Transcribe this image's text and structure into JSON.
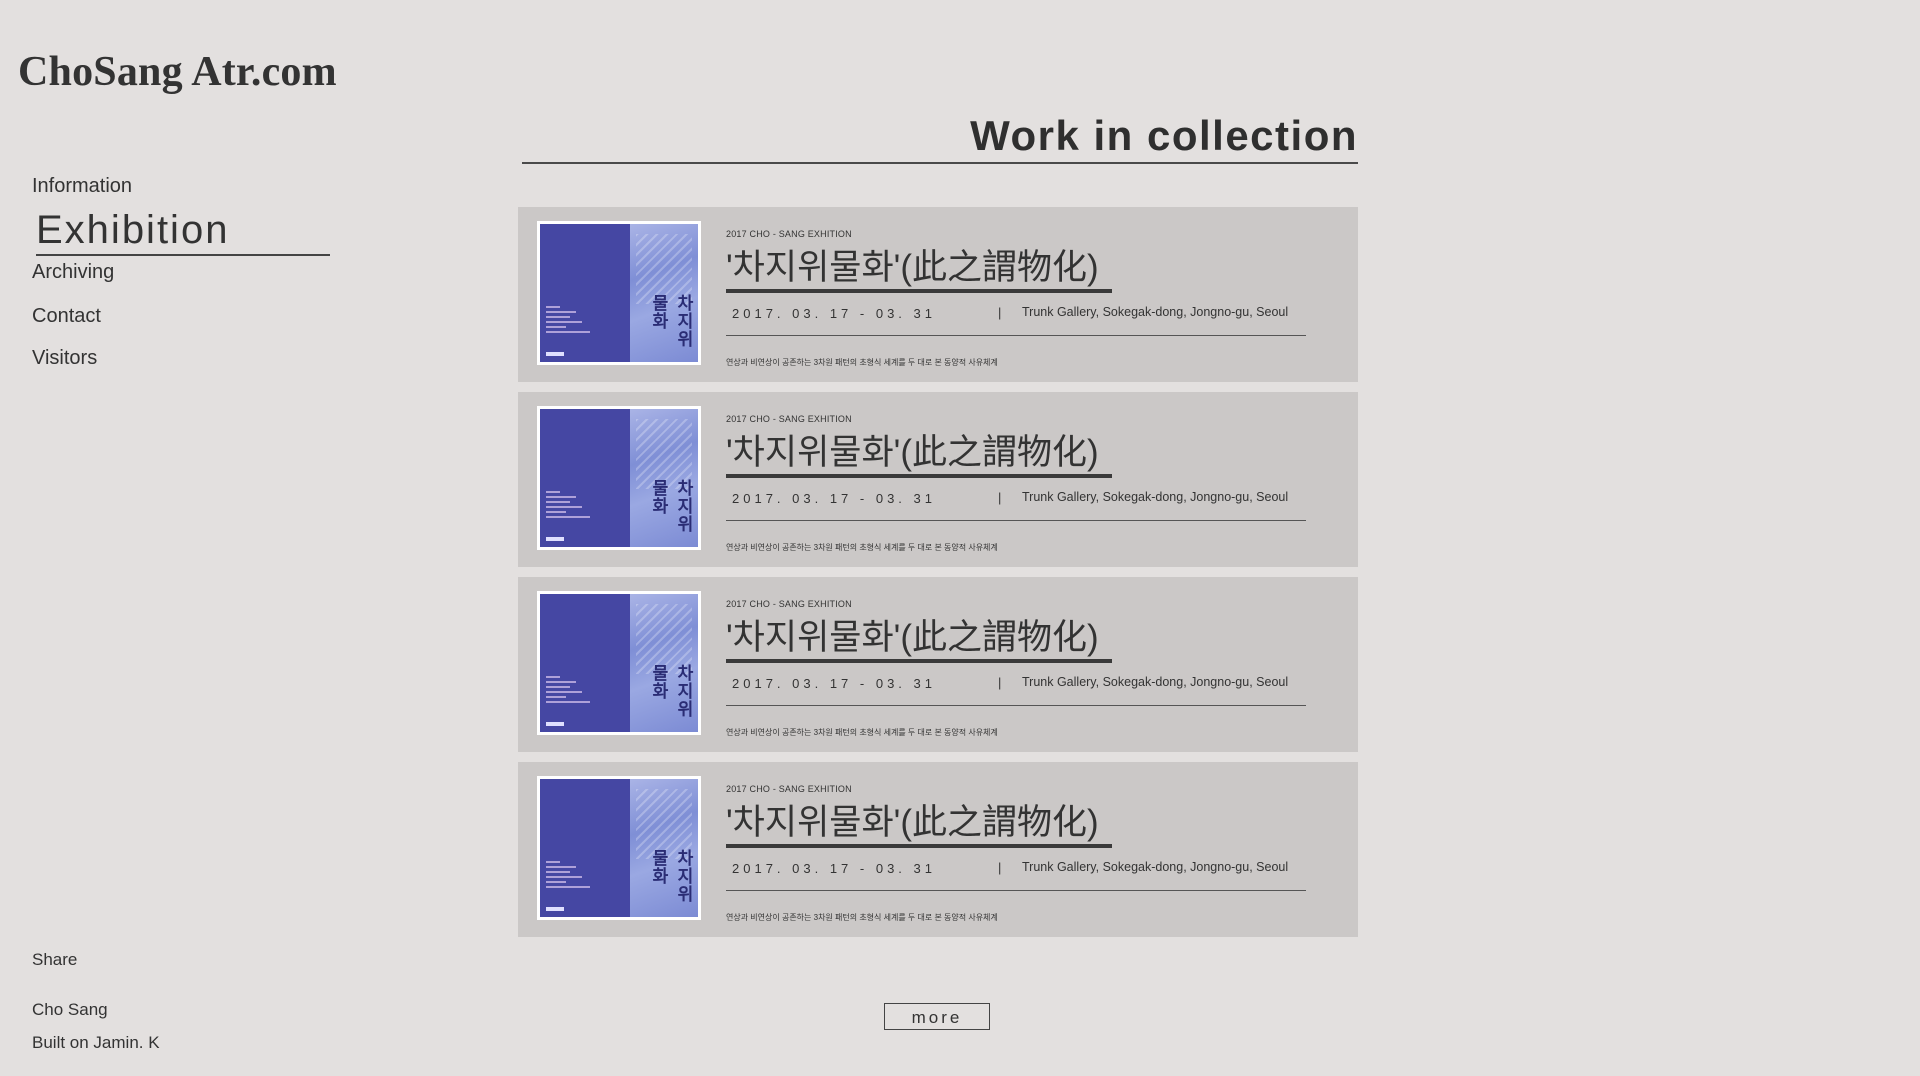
{
  "site": {
    "logo": "ChoSang Atr.com"
  },
  "nav": {
    "items": [
      {
        "label": "Information"
      },
      {
        "label": "Exhibition"
      },
      {
        "label": "Archiving"
      },
      {
        "label": "Contact"
      },
      {
        "label": "Visitors"
      }
    ],
    "active": "Exhibition"
  },
  "main": {
    "title": "Work in collection",
    "cards": [
      {
        "kicker": "2017   CHO - SANG   EXHITION",
        "title": "'차지위물화'(此之謂物化)",
        "date": "2017. 03. 17  -  03. 31",
        "separator": "|",
        "venue": "Trunk Gallery, Sokegak-dong, Jongno-gu, Seoul",
        "description": "연상과 비연상이 공존하는 3차원 패턴의 초형식 세계를 두 대로 본 동양적 사유체계",
        "poster_text": "차지위물화"
      },
      {
        "kicker": "2017   CHO - SANG   EXHITION",
        "title": "'차지위물화'(此之謂物化)",
        "date": "2017. 03. 17  -  03. 31",
        "separator": "|",
        "venue": "Trunk Gallery, Sokegak-dong, Jongno-gu, Seoul",
        "description": "연상과 비연상이 공존하는 3차원 패턴의 초형식 세계를 두 대로 본 동양적 사유체계",
        "poster_text": "차지위물화"
      },
      {
        "kicker": "2017   CHO - SANG   EXHITION",
        "title": "'차지위물화'(此之謂物化)",
        "date": "2017. 03. 17  -  03. 31",
        "separator": "|",
        "venue": "Trunk Gallery, Sokegak-dong, Jongno-gu, Seoul",
        "description": "연상과 비연상이 공존하는 3차원 패턴의 초형식 세계를 두 대로 본 동양적 사유체계",
        "poster_text": "차지위물화"
      },
      {
        "kicker": "2017   CHO - SANG   EXHITION",
        "title": "'차지위물화'(此之謂物化)",
        "date": "2017. 03. 17  -  03. 31",
        "separator": "|",
        "venue": "Trunk Gallery, Sokegak-dong, Jongno-gu, Seoul",
        "description": "연상과 비연상이 공존하는 3차원 패턴의 초형식 세계를 두 대로 본 동양적 사유체계",
        "poster_text": "차지위물화"
      }
    ],
    "more_label": "more"
  },
  "footer": {
    "share": "Share",
    "author": "Cho Sang",
    "built": "Built on Jamin. K"
  },
  "colors": {
    "background": "#e3e0df",
    "card": "#cbc8c7",
    "poster_blue": "#4547a3",
    "text": "#2f2f2f"
  }
}
